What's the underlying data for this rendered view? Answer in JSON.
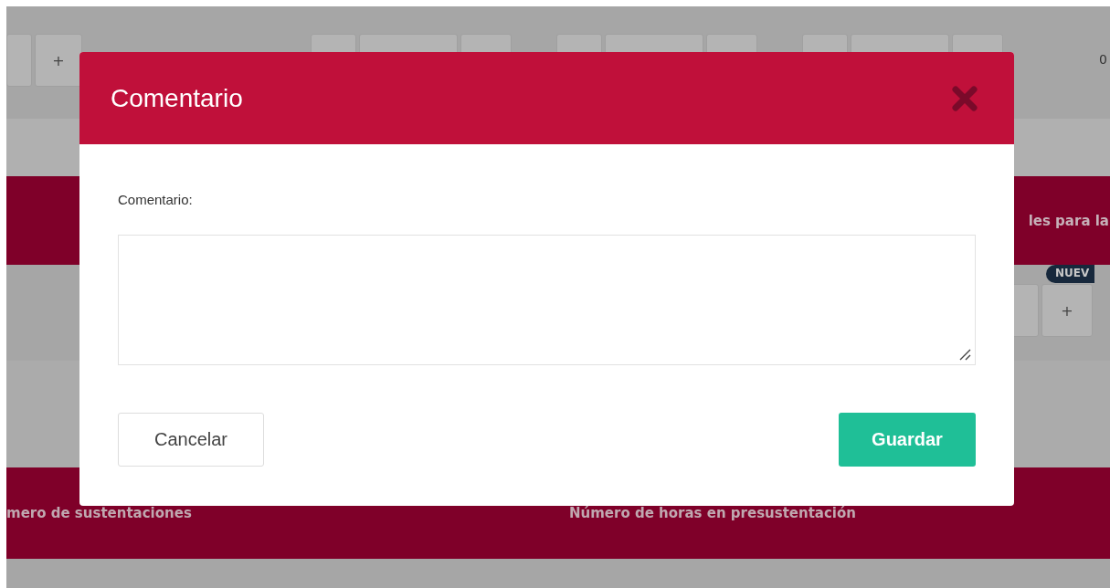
{
  "background": {
    "top_row": {
      "left_button": "+",
      "right_value": "0"
    },
    "banner_text": "les para la",
    "badge": "NUEV",
    "add_button": "+",
    "table_headers": [
      "mero de sustentaciones",
      "Número de horas en presustentación"
    ]
  },
  "modal": {
    "title": "Comentario",
    "field_label": "Comentario:",
    "buttons": [
      {
        "label": "Cancelar",
        "kind": "secondary"
      },
      {
        "label": "Guardar",
        "kind": "primary"
      }
    ]
  }
}
